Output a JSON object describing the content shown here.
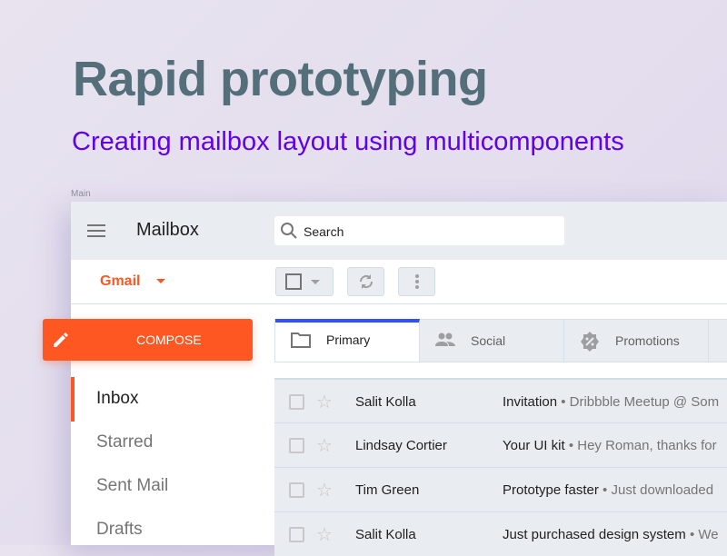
{
  "hero": {
    "title": "Rapid prototyping",
    "subtitle": "Creating mailbox layout using multicomponents",
    "frame_label": "Main"
  },
  "header": {
    "app_title": "Mailbox",
    "search_placeholder": "Search"
  },
  "toolbar": {
    "account": "Gmail"
  },
  "compose": {
    "label": "COMPOSE"
  },
  "sidebar": {
    "items": [
      {
        "label": "Inbox",
        "active": true
      },
      {
        "label": "Starred"
      },
      {
        "label": "Sent Mail"
      },
      {
        "label": "Drafts"
      }
    ]
  },
  "tabs": [
    {
      "label": "Primary",
      "icon": "folder-icon",
      "active": true
    },
    {
      "label": "Social",
      "icon": "people-icon"
    },
    {
      "label": "Promotions",
      "icon": "discount-badge-icon"
    }
  ],
  "emails": [
    {
      "sender": "Salit Kolla",
      "subject": "Invitation",
      "snippet": " • Dribbble Meetup @ Som"
    },
    {
      "sender": "Lindsay Cortier",
      "subject": "Your UI kit",
      "snippet": " • Hey Roman, thanks for"
    },
    {
      "sender": "Tim Green",
      "subject": "Prototype faster",
      "snippet": " • Just downloaded"
    },
    {
      "sender": "Salit Kolla",
      "subject": "Just purchased design system",
      "snippet": " • We"
    }
  ],
  "colors": {
    "accent": "#ff5722",
    "tab_indicator": "#304ffe",
    "title": "#546e7a",
    "subtitle": "#6200ea"
  }
}
